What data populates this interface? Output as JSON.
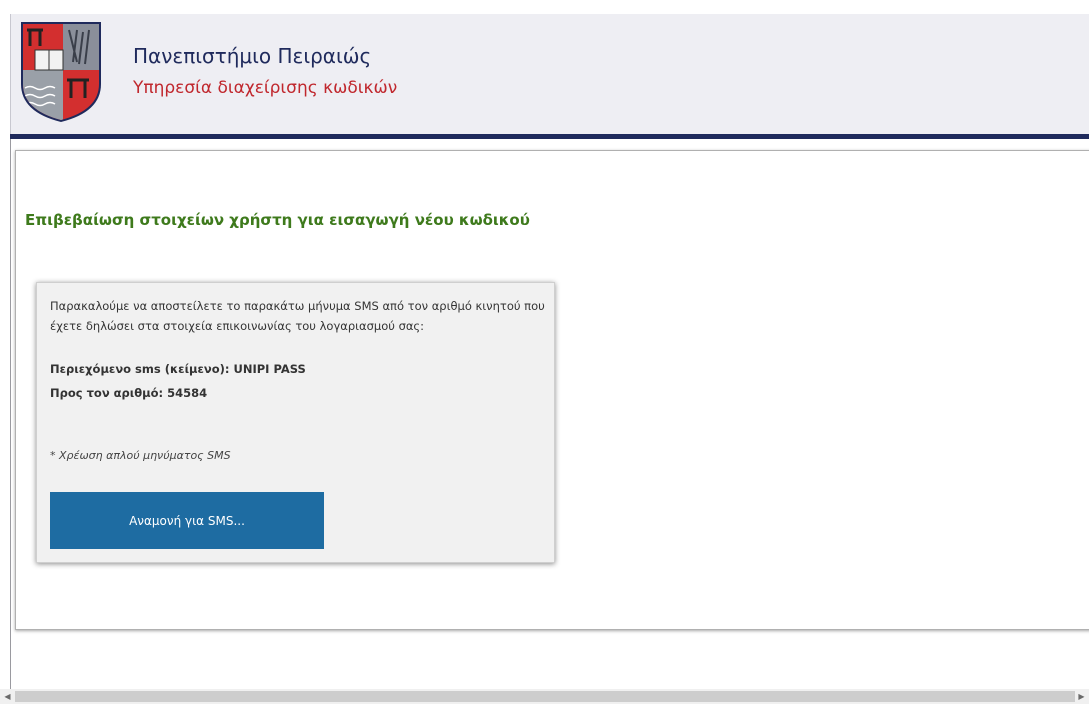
{
  "header": {
    "title": "Πανεπιστήμιο Πειραιώς",
    "subtitle": "Υπηρεσία διαχείρισης κωδικών",
    "logo_icon": "university-crest-icon"
  },
  "main": {
    "heading": "Επιβεβαίωση στοιχείων χρήστη για εισαγωγή νέου κωδικού"
  },
  "sms_box": {
    "instructions": "Παρακαλούμε να αποστείλετε το παρακάτω μήνυμα SMS από τον αριθμό κινητού που έχετε δηλώσει στα στοιχεία επικοινωνίας του λογαριασμού σας:",
    "content_line": "Περιεχόμενο sms (κείμενο): UNIPI PASS",
    "number_line": "Προς τον αριθμό: 54584",
    "charge_note": "* Χρέωση απλού μηνύματος SMS",
    "button_label": "Αναμονή για SMS..."
  },
  "scrollbar": {
    "left_arrow": "◀",
    "right_arrow": "▶"
  },
  "colors": {
    "header_bg": "#eeeef3",
    "header_rule": "#1f2a5c",
    "title": "#1f2a5c",
    "subtitle": "#c0272d",
    "heading": "#3e7a1c",
    "button_bg": "#1e6ca2",
    "box_bg": "#f1f1f1"
  }
}
